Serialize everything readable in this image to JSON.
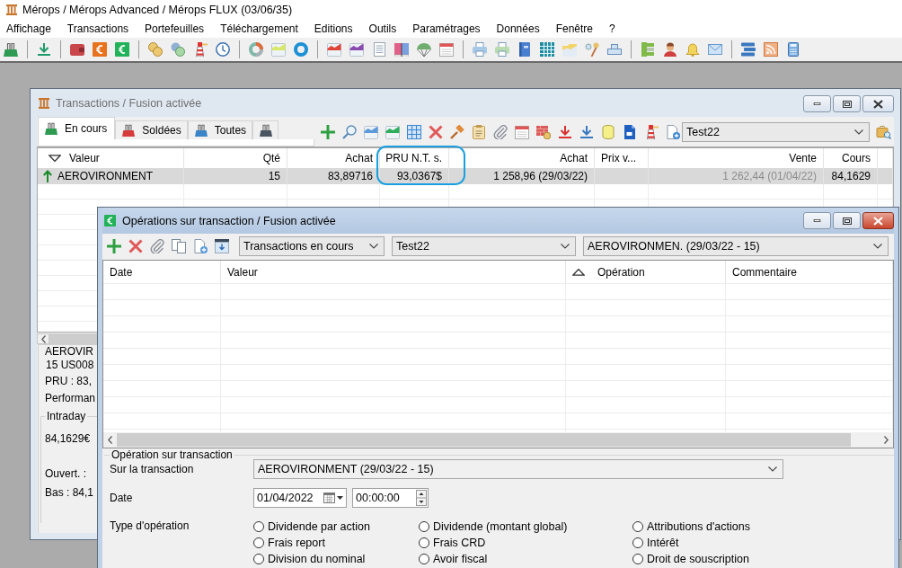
{
  "app": {
    "title": "Mérops / Mérops Advanced / Mérops FLUX (03/06/35)",
    "menu": [
      "Affichage",
      "Transactions",
      "Portefeuilles",
      "Téléchargement",
      "Editions",
      "Outils",
      "Paramétrages",
      "Données",
      "Fenêtre",
      "?"
    ]
  },
  "transactions_window": {
    "title": "Transactions / Fusion activée",
    "active": false,
    "tabs": [
      {
        "label": "En cours",
        "color": "#2e9a52",
        "selected": true
      },
      {
        "label": "Soldées",
        "color": "#d63b3b",
        "selected": false
      },
      {
        "label": "Toutes",
        "color": "#3a84c8",
        "selected": false
      },
      {
        "color": "#4a5562",
        "selected": false
      }
    ],
    "portfolio": "Test22",
    "table": {
      "columns": [
        {
          "label": "Valeur",
          "sorted_descending": true
        },
        {
          "label": "Qté"
        },
        {
          "label": "Achat"
        },
        {
          "label": "PRU N.T. s.",
          "highlighted": true
        },
        {
          "label": "Achat"
        },
        {
          "label": "Prix v..."
        },
        {
          "label": "Vente",
          "muted": true
        },
        {
          "label": "Cours"
        }
      ],
      "rows": [
        {
          "selected": true,
          "rising": true,
          "cells": [
            "AEROVIRONMENT",
            "15",
            "83,89716",
            "93,0367$",
            "1 258,96 (29/03/22)",
            null,
            "1 262,44 (01/04/22)",
            "84,1629"
          ]
        }
      ]
    },
    "details": {
      "lines": [
        "AEROVIR",
        "15 US008",
        "PRU : 83,",
        "Performan"
      ],
      "intraday": {
        "title": "Intraday",
        "lines": [
          "84,1629€",
          "Ouvert. :",
          "Bas : 84,1"
        ]
      }
    }
  },
  "operations_window": {
    "title": "Opérations sur transaction / Fusion activée",
    "active": true,
    "filters": [
      "Transactions en cours",
      "Test22",
      "AEROVIRONMEN. (29/03/22 - 15)"
    ],
    "table": {
      "columns": [
        {
          "label": "Date"
        },
        {
          "label": "Valeur"
        },
        {
          "label": "Opération",
          "sorted_ascending": true
        },
        {
          "label": "Commentaire"
        }
      ]
    },
    "form": {
      "title": "Opération sur transaction",
      "transaction": {
        "label": "Sur la transaction",
        "value": "AEROVIRONMENT (29/03/22 - 15)"
      },
      "date": {
        "label": "Date",
        "date": "01/04/2022",
        "time": "00:00:00"
      },
      "operation_type": {
        "label": "Type d'opération",
        "options": [
          {
            "label": "Dividende par action",
            "selected": false
          },
          {
            "label": "Dividende (montant global)",
            "selected": false
          },
          {
            "label": "Attributions d'actions",
            "selected": false
          },
          {
            "label": "Frais report",
            "selected": false
          },
          {
            "label": "Frais CRD",
            "selected": false
          },
          {
            "label": "Intérêt",
            "selected": false
          },
          {
            "label": "Division du nominal",
            "selected": false
          },
          {
            "label": "Avoir fiscal",
            "selected": false
          },
          {
            "label": "Droit de souscription",
            "selected": false
          }
        ]
      }
    }
  }
}
